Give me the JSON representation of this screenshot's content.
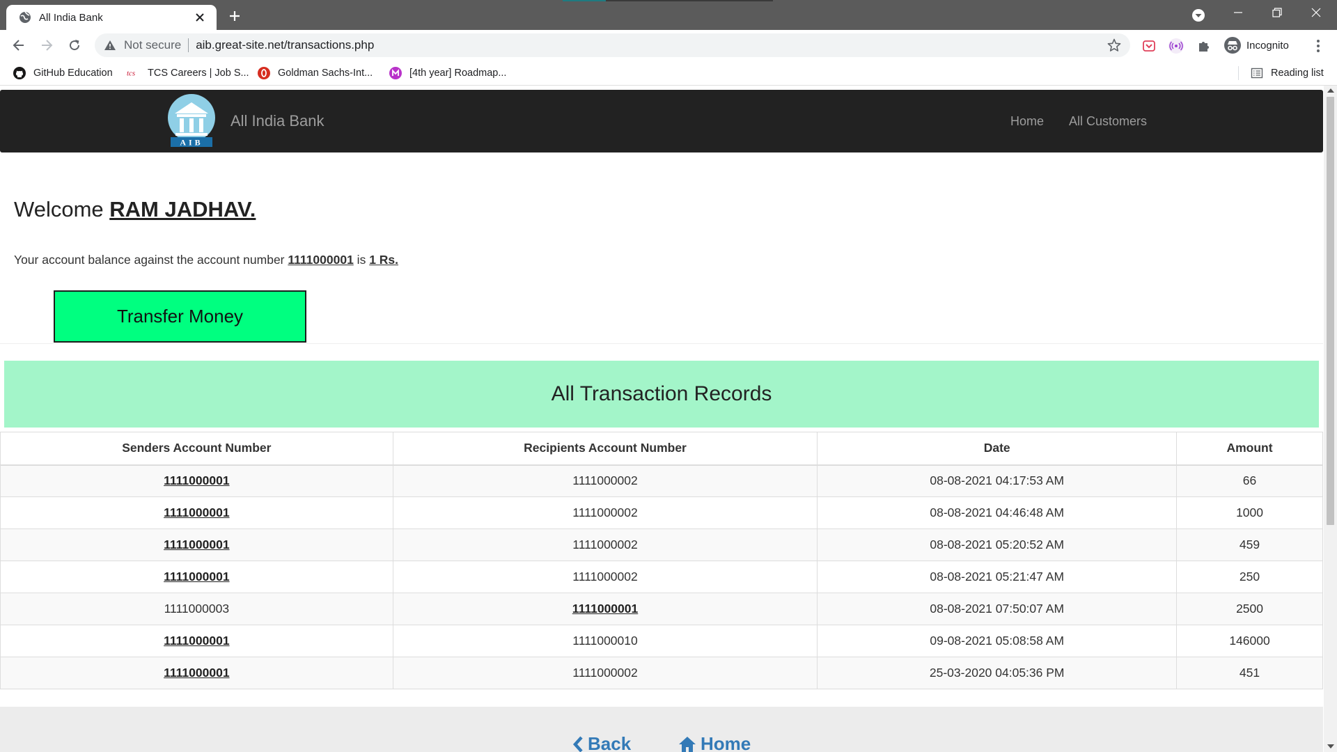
{
  "browser": {
    "tab_title": "All India Bank",
    "omnibox_security": "Not secure",
    "url": "aib.great-site.net/transactions.php",
    "profile_label": "Incognito",
    "bookmarks": [
      {
        "label": "GitHub Education",
        "icon": "github-icon"
      },
      {
        "label": "TCS Careers | Job S...",
        "icon": "tcs-icon"
      },
      {
        "label": "Goldman Sachs-Int...",
        "icon": "goldman-sachs-icon"
      },
      {
        "label": "[4th year] Roadmap...",
        "icon": "medium-m-icon"
      }
    ],
    "reading_list": "Reading list"
  },
  "site": {
    "brand": "All India Bank",
    "logo_text": "AIB",
    "nav": {
      "home": "Home",
      "customers": "All Customers"
    }
  },
  "account": {
    "welcome_prefix": "Welcome ",
    "customer_name": "RAM JADHAV.",
    "balance_prefix": "Your account balance against the account number ",
    "account_number": "1111000001",
    "balance_mid": " is ",
    "balance": "1 Rs.",
    "transfer_button": "Transfer Money"
  },
  "records": {
    "title": "All Transaction Records",
    "columns": [
      "Senders Account Number",
      "Recipients Account Number",
      "Date",
      "Amount"
    ],
    "rows": [
      {
        "sender": "1111000001",
        "recipient": "1111000002",
        "date": "08-08-2021 04:17:53 AM",
        "amount": "66",
        "highlight": "sender"
      },
      {
        "sender": "1111000001",
        "recipient": "1111000002",
        "date": "08-08-2021 04:46:48 AM",
        "amount": "1000",
        "highlight": "sender"
      },
      {
        "sender": "1111000001",
        "recipient": "1111000002",
        "date": "08-08-2021 05:20:52 AM",
        "amount": "459",
        "highlight": "sender"
      },
      {
        "sender": "1111000001",
        "recipient": "1111000002",
        "date": "08-08-2021 05:21:47 AM",
        "amount": "250",
        "highlight": "sender"
      },
      {
        "sender": "1111000003",
        "recipient": "1111000001",
        "date": "08-08-2021 07:50:07 AM",
        "amount": "2500",
        "highlight": "recipient"
      },
      {
        "sender": "1111000001",
        "recipient": "1111000010",
        "date": "09-08-2021 05:08:58 AM",
        "amount": "146000",
        "highlight": "sender"
      },
      {
        "sender": "1111000001",
        "recipient": "1111000002",
        "date": "25-03-2020 04:05:36 PM",
        "amount": "451",
        "highlight": "sender"
      }
    ]
  },
  "footer": {
    "back": "Back",
    "home": "Home"
  },
  "colors": {
    "navbar": "#222222",
    "transfer_button": "#00ff80",
    "records_header": "#a3f5c9",
    "footer_link": "#337ab7"
  }
}
